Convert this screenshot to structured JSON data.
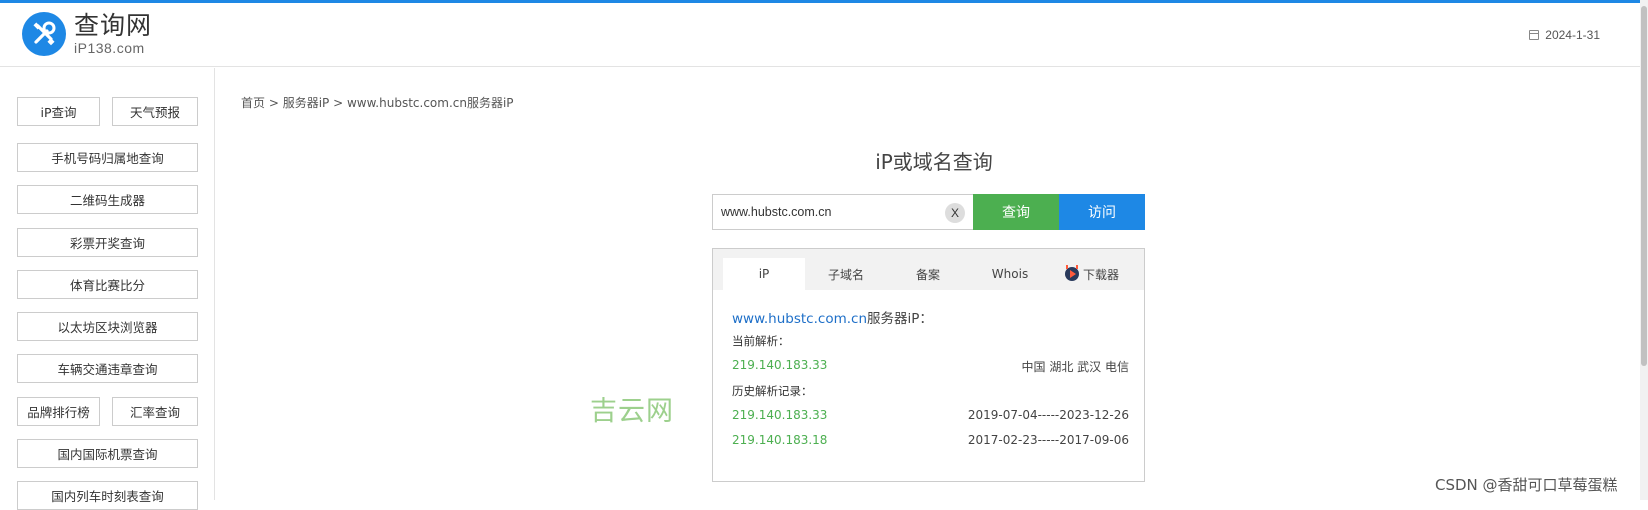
{
  "header": {
    "logo_title": "查询网",
    "logo_sub": "iP138.com",
    "date": "2024-1-31"
  },
  "sidebar": {
    "items": [
      {
        "label": "iP查询"
      },
      {
        "label": "天气预报"
      },
      {
        "label": "手机号码归属地查询"
      },
      {
        "label": "二维码生成器"
      },
      {
        "label": "彩票开奖查询"
      },
      {
        "label": "体育比赛比分"
      },
      {
        "label": "以太坊区块浏览器"
      },
      {
        "label": "车辆交通违章查询"
      },
      {
        "label": "品牌排行榜"
      },
      {
        "label": "汇率查询"
      },
      {
        "label": "国内国际机票查询"
      },
      {
        "label": "国内列车时刻表查询"
      }
    ]
  },
  "breadcrumb": {
    "home": "首页",
    "sep": " > ",
    "section": "服务器iP",
    "current": "www.hubstc.com.cn服务器iP"
  },
  "query": {
    "title": "iP或域名查询",
    "input_value": "www.hubstc.com.cn",
    "clear_label": "X",
    "query_label": "查询",
    "visit_label": "访问"
  },
  "tabs": [
    {
      "label": "iP",
      "active": true
    },
    {
      "label": "子域名"
    },
    {
      "label": "备案"
    },
    {
      "label": "Whois"
    },
    {
      "label": "下载器"
    }
  ],
  "result": {
    "domain": "www.hubstc.com.cn",
    "domain_suffix": "服务器iP：",
    "current_label": "当前解析：",
    "current_ip": "219.140.183.33",
    "current_location": "中国 湖北 武汉 电信",
    "history_label": "历史解析记录：",
    "history": [
      {
        "ip": "219.140.183.33",
        "range": "2019-07-04-----2023-12-26"
      },
      {
        "ip": "219.140.183.18",
        "range": "2017-02-23-----2017-09-06"
      }
    ]
  },
  "watermarks": {
    "center": "吉云网",
    "corner": "CSDN @香甜可口草莓蛋糕"
  },
  "colors": {
    "accent_blue": "#1e88e5",
    "accent_green": "#4caf50"
  }
}
